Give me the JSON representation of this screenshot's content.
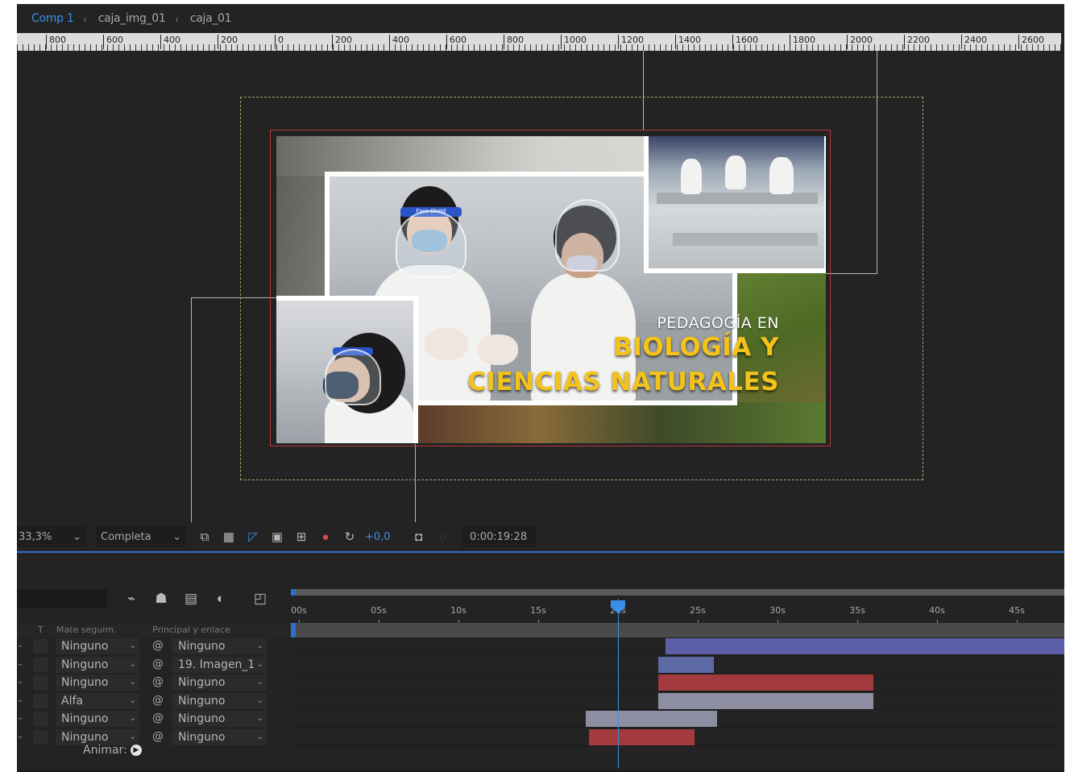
{
  "breadcrumb": {
    "items": [
      "Comp 1",
      "caja_img_01",
      "caja_01"
    ],
    "separator": "‹"
  },
  "ruler": {
    "labels": [
      "800",
      "600",
      "400",
      "200",
      "0",
      "200",
      "400",
      "600",
      "800",
      "1000",
      "1200",
      "1400",
      "1600",
      "1800",
      "2000",
      "2200",
      "2400",
      "2600"
    ]
  },
  "composition": {
    "subtitle": "PEDAGOGÍA EN",
    "title_line1": "BIOLOGÍA Y",
    "title_line2": "CIENCIAS NATURALES",
    "shield_band_text": "Face Shield"
  },
  "viewer_toolbar": {
    "zoom": "33,3%",
    "resolution": "Completa",
    "exposure": "+0,0",
    "timecode": "0:00:19:28",
    "icons": [
      "region-of-interest-icon",
      "transparency-grid-icon",
      "mask-path-icon",
      "safe-zones-icon",
      "grid-icon",
      "channel-icon",
      "reset-exposure-icon",
      "snapshot-icon",
      "show-snapshot-icon"
    ]
  },
  "timeline": {
    "tools": [
      "draft-3d-icon",
      "shy-layers-icon",
      "frame-blend-icon",
      "motion-blur-icon",
      "graph-editor-icon"
    ],
    "columns": {
      "t": "T",
      "matte": "Mate seguim.",
      "parent": "Principal y enlace"
    },
    "time_labels": [
      "00s",
      "05s",
      "10s",
      "15s",
      "20s",
      "25s",
      "30s",
      "35s",
      "40s",
      "45s"
    ],
    "layers": [
      {
        "matte": "Ninguno",
        "parent": "Ninguno",
        "clip_color": "#5a5fa8",
        "clip_start_s": 23.0,
        "clip_end_s": 48.0
      },
      {
        "matte": "Ninguno",
        "parent": "19. Imagen_1",
        "clip_color": "#5d6aa6",
        "clip_start_s": 22.5,
        "clip_end_s": 26.0
      },
      {
        "matte": "Ninguno",
        "parent": "Ninguno",
        "clip_color": "#a33a3e",
        "clip_start_s": 22.5,
        "clip_end_s": 36.0
      },
      {
        "matte": "Alfa",
        "parent": "Ninguno",
        "clip_color": "#8e8ea2",
        "clip_start_s": 22.5,
        "clip_end_s": 36.0
      },
      {
        "matte": "Ninguno",
        "parent": "Ninguno",
        "clip_color": "#8e8ea2",
        "clip_start_s": 18.0,
        "clip_end_s": 26.2
      },
      {
        "matte": "Ninguno",
        "parent": "Ninguno",
        "clip_color": "#a33a3e",
        "clip_start_s": 18.2,
        "clip_end_s": 24.8
      }
    ],
    "playhead_s": 20.0,
    "animate_label": "Animar:"
  },
  "colors": {
    "accent": "#3b8fe6",
    "title_yellow": "#f4c21a",
    "frame_red": "#b3383c"
  }
}
